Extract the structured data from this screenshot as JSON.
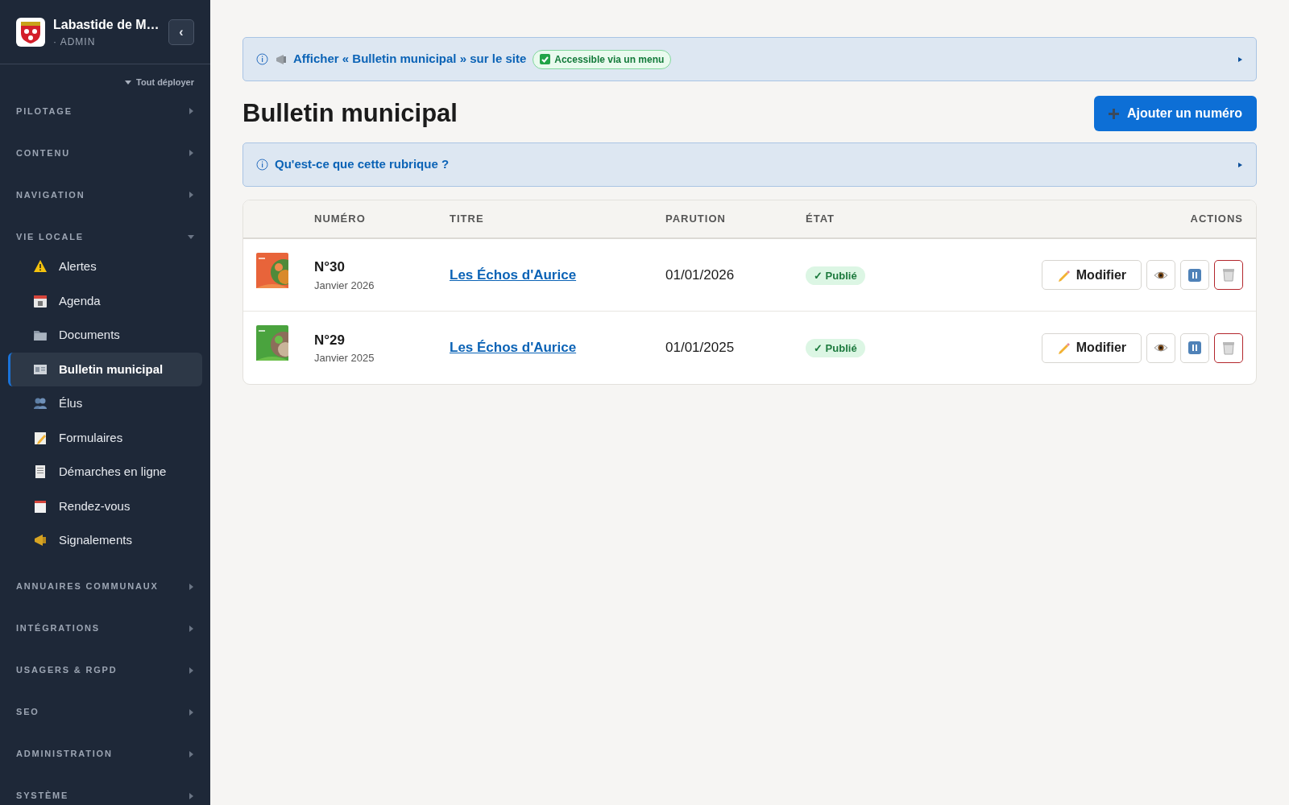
{
  "brand": {
    "title": "Labastide de M…",
    "subtitle": "· ADMIN"
  },
  "collapse_button": "‹",
  "expand_all": "Tout déployer",
  "sections": [
    {
      "label": "PILOTAGE",
      "expanded": false
    },
    {
      "label": "CONTENU",
      "expanded": false
    },
    {
      "label": "NAVIGATION",
      "expanded": false
    },
    {
      "label": "VIE LOCALE",
      "expanded": true,
      "items": [
        {
          "label": "Alertes",
          "selected": false
        },
        {
          "label": "Agenda",
          "selected": false
        },
        {
          "label": "Documents",
          "selected": false
        },
        {
          "label": "Bulletin municipal",
          "selected": true
        },
        {
          "label": "Élus",
          "selected": false
        },
        {
          "label": "Formulaires",
          "selected": false
        },
        {
          "label": "Démarches en ligne",
          "selected": false
        },
        {
          "label": "Rendez-vous",
          "selected": false
        },
        {
          "label": "Signalements",
          "selected": false
        }
      ]
    },
    {
      "label": "ANNUAIRES COMMUNAUX",
      "expanded": false
    },
    {
      "label": "INTÉGRATIONS",
      "expanded": false
    },
    {
      "label": "USAGERS & RGPD",
      "expanded": false
    },
    {
      "label": "SEO",
      "expanded": false
    },
    {
      "label": "ADMINISTRATION",
      "expanded": false
    },
    {
      "label": "SYSTÈME",
      "expanded": false
    }
  ],
  "site_panel": {
    "link": "Afficher « Bulletin municipal » sur le site",
    "badge": "Accessible via un menu",
    "expanded": false
  },
  "page_title": "Bulletin municipal",
  "add_button": "Ajouter un numéro",
  "help_panel": {
    "link": "Qu'est-ce que cette rubrique ?",
    "expanded": false
  },
  "table": {
    "columns": [
      "NUMÉRO",
      "TITRE",
      "PARUTION",
      "ÉTAT",
      "ACTIONS"
    ],
    "rows": [
      {
        "number": "N°30",
        "month": "Janvier 2026",
        "title": "Les Échos d'Aurice",
        "date": "01/01/2026",
        "status": "✓ Publié",
        "published": true,
        "edit": "Modifier"
      },
      {
        "number": "N°29",
        "month": "Janvier 2025",
        "title": "Les Échos d'Aurice",
        "date": "01/01/2025",
        "status": "✓ Publié",
        "published": true,
        "edit": "Modifier"
      }
    ]
  }
}
